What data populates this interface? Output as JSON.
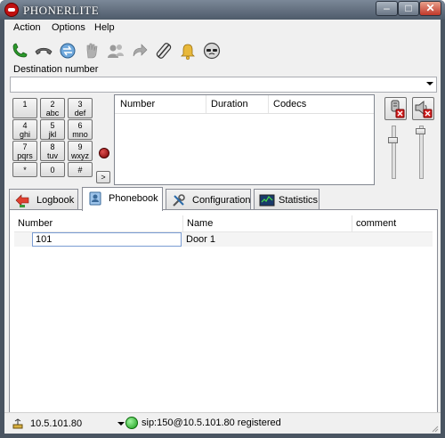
{
  "window": {
    "title": "PHONERLITE",
    "minimize_label": "–",
    "maximize_label": "□",
    "close_label": "✕"
  },
  "menu": {
    "items": [
      {
        "label": "Action"
      },
      {
        "label": "Options"
      },
      {
        "label": "Help"
      }
    ]
  },
  "toolbar": {
    "icons": [
      "dial-phone-icon",
      "hangup-phone-icon",
      "transfer-icon",
      "hold-hand-icon",
      "contacts-icon",
      "forward-arrow-icon",
      "mute-mic-icon",
      "bell-icon",
      "do-not-disturb-icon"
    ]
  },
  "destination": {
    "label": "Destination number",
    "value": ""
  },
  "keypad": {
    "keys": [
      {
        "main": "1",
        "sub": ""
      },
      {
        "main": "2",
        "sub": "abc"
      },
      {
        "main": "3",
        "sub": "def"
      },
      {
        "main": "4",
        "sub": "ghi"
      },
      {
        "main": "5",
        "sub": "jkl"
      },
      {
        "main": "6",
        "sub": "mno"
      },
      {
        "main": "7",
        "sub": "pqrs"
      },
      {
        "main": "8",
        "sub": "tuv"
      },
      {
        "main": "9",
        "sub": "wxyz"
      },
      {
        "main": "*",
        "sub": ""
      },
      {
        "main": "0",
        "sub": ""
      },
      {
        "main": "#",
        "sub": ""
      }
    ],
    "more_label": ">"
  },
  "calls_table": {
    "columns": [
      "Number",
      "Duration",
      "Codecs"
    ]
  },
  "tabs": [
    {
      "label": "Logbook",
      "icon": "logbook-icon"
    },
    {
      "label": "Phonebook",
      "icon": "phonebook-icon"
    },
    {
      "label": "Configuration",
      "icon": "configuration-tools-icon"
    },
    {
      "label": "Statistics",
      "icon": "statistics-monitor-icon"
    }
  ],
  "phonebook": {
    "columns": [
      "Number",
      "Name",
      "comment"
    ],
    "rows": [
      {
        "number": "101",
        "name": "Door 1",
        "comment": ""
      }
    ]
  },
  "status": {
    "ip": "10.5.101.80",
    "registration": "sip:150@10.5.101.80 registered",
    "colors": {
      "registered": "#1a9d1a"
    }
  }
}
